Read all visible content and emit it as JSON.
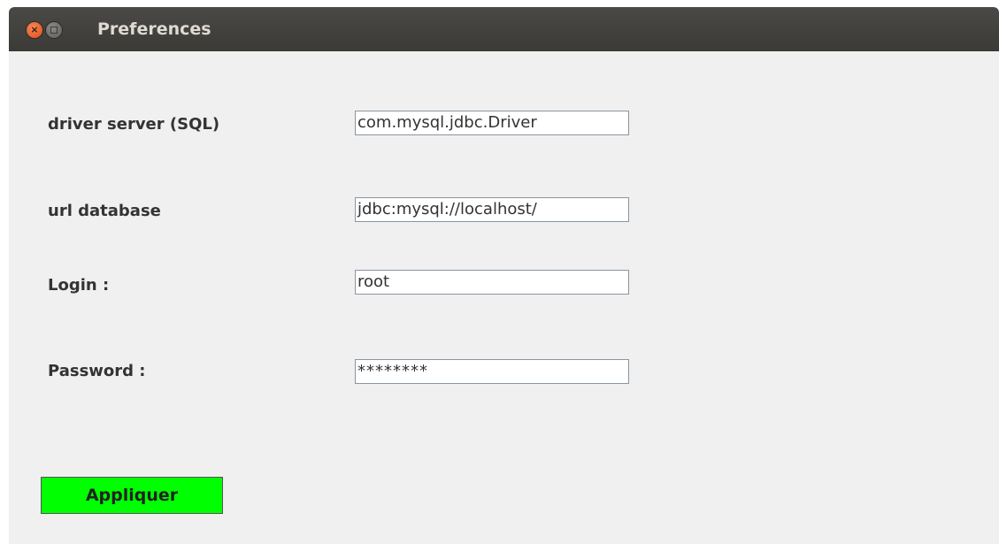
{
  "window": {
    "title": "Preferences"
  },
  "form": {
    "driver": {
      "label": "driver server (SQL)",
      "value": "com.mysql.jdbc.Driver"
    },
    "url": {
      "label": "url database",
      "value": "jdbc:mysql://localhost/"
    },
    "login": {
      "label": "Login :",
      "value": "root"
    },
    "password": {
      "label": "Password :",
      "value": "********"
    }
  },
  "actions": {
    "apply_label": "Appliquer"
  },
  "colors": {
    "apply_button": "#00ff00",
    "titlebar": "#3c3b37",
    "window_bg": "#f0f0f0"
  }
}
